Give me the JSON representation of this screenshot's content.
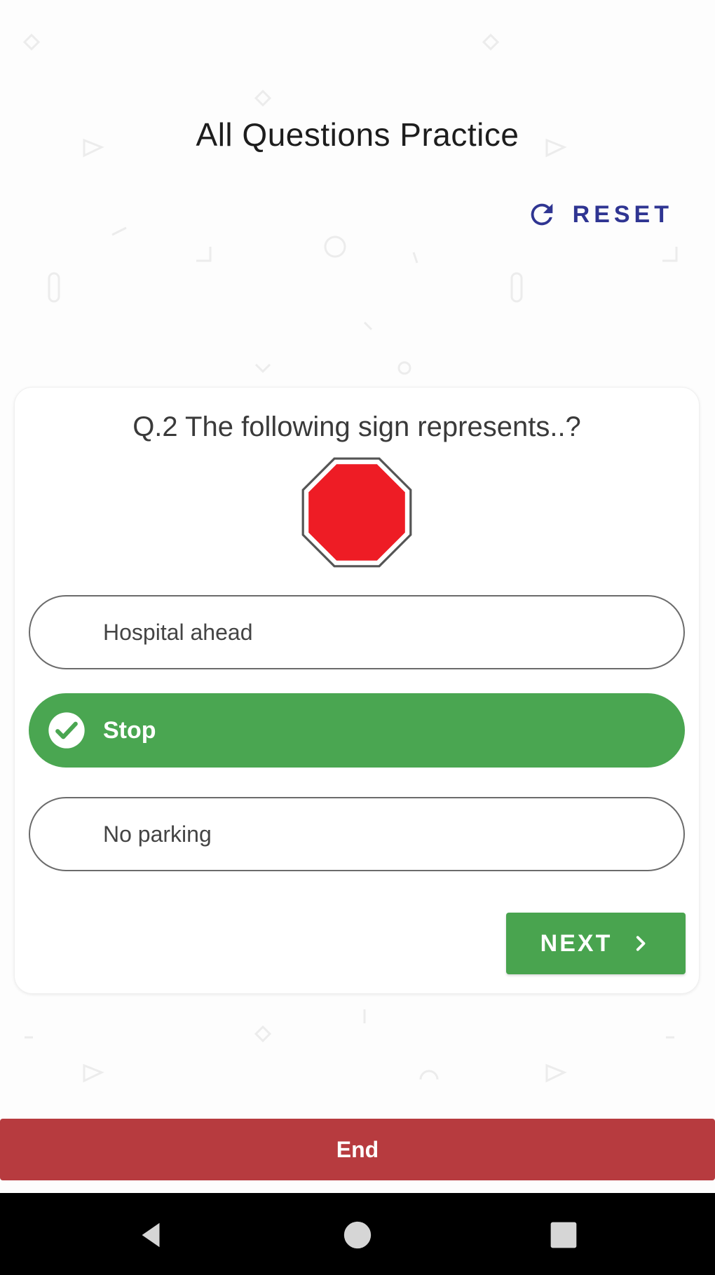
{
  "header": {
    "title": "All Questions Practice",
    "reset_label": "RESET",
    "reset_icon": "refresh-icon"
  },
  "question": {
    "text": "Q.2 The following sign represents..?",
    "sign_icon": "stop-sign-octagon",
    "options": [
      {
        "label": "Hospital ahead",
        "state": "unselected"
      },
      {
        "label": "Stop",
        "state": "correct"
      },
      {
        "label": "No parking",
        "state": "unselected"
      }
    ],
    "next_label": "NEXT",
    "next_icon": "chevron-right-icon"
  },
  "footer": {
    "end_label": "End"
  },
  "system_nav": {
    "back_icon": "back-triangle-icon",
    "home_icon": "home-circle-icon",
    "recents_icon": "recents-square-icon"
  },
  "colors": {
    "correct_green": "#4aa651",
    "next_green": "#49a44f",
    "end_red": "#b73b3f",
    "reset_blue": "#2f3592",
    "stop_red": "#ee1c25"
  }
}
